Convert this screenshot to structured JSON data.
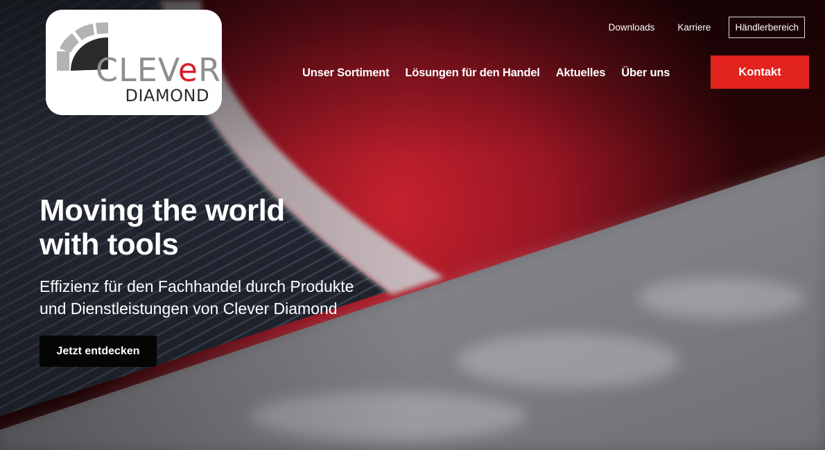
{
  "logo": {
    "word_start": "CLEV",
    "word_accent": "e",
    "word_end": "R",
    "subtitle": "DIAMOND"
  },
  "top_nav": {
    "downloads": "Downloads",
    "karriere": "Karriere",
    "haendlerbereich": "Händlerbereich"
  },
  "main_nav": {
    "items": [
      "Unser Sortiment",
      "Lösungen für den Handel",
      "Aktuelles",
      "Über uns"
    ],
    "cta": "Kontakt"
  },
  "hero": {
    "headline_line1": "Moving the world",
    "headline_line2": "with tools",
    "subline_line1": "Effizienz für den Fachhandel durch Produkte",
    "subline_line2": "und Dienstleistungen von Clever Diamond",
    "cta": "Jetzt entdecken"
  },
  "colors": {
    "accent_red": "#e3231d",
    "logo_red": "#d8202a",
    "button_dark": "#050505"
  }
}
